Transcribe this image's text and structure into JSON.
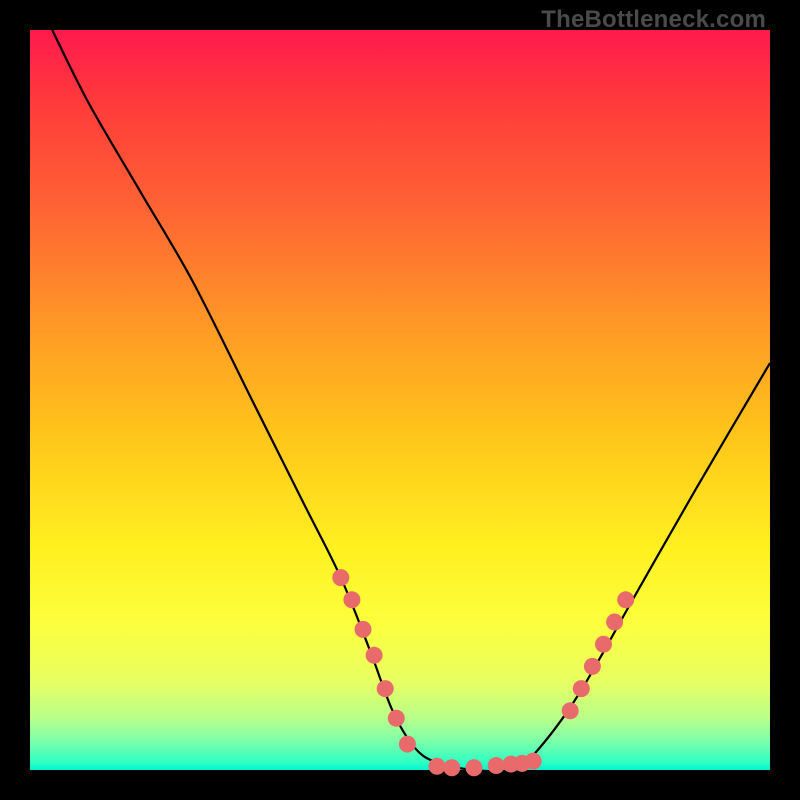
{
  "watermark": "TheBottleneck.com",
  "chart_data": {
    "type": "line",
    "title": "",
    "xlabel": "",
    "ylabel": "",
    "xlim": [
      0,
      100
    ],
    "ylim": [
      0,
      100
    ],
    "series": [
      {
        "name": "curve",
        "x": [
          3,
          8,
          15,
          22,
          30,
          37,
          42,
          46,
          49,
          52,
          55,
          60,
          65,
          68,
          74,
          82,
          90,
          100
        ],
        "values": [
          100,
          90,
          78,
          66,
          50,
          36,
          26,
          16,
          8,
          3,
          1,
          0,
          0,
          2,
          10,
          24,
          38,
          55
        ]
      }
    ],
    "annotations": {
      "dots_left_branch": [
        {
          "x": 42,
          "y": 26
        },
        {
          "x": 43.5,
          "y": 23
        },
        {
          "x": 45,
          "y": 19
        },
        {
          "x": 46.5,
          "y": 15.5
        },
        {
          "x": 48,
          "y": 11
        },
        {
          "x": 49.5,
          "y": 7
        },
        {
          "x": 51,
          "y": 3.5
        }
      ],
      "dots_bottom": [
        {
          "x": 55,
          "y": 0.5
        },
        {
          "x": 57,
          "y": 0.3
        },
        {
          "x": 60,
          "y": 0.3
        },
        {
          "x": 63,
          "y": 0.6
        },
        {
          "x": 65,
          "y": 0.8
        },
        {
          "x": 66.5,
          "y": 0.9
        },
        {
          "x": 68,
          "y": 1.2
        }
      ],
      "dots_right_branch": [
        {
          "x": 73,
          "y": 8
        },
        {
          "x": 74.5,
          "y": 11
        },
        {
          "x": 76,
          "y": 14
        },
        {
          "x": 77.5,
          "y": 17
        },
        {
          "x": 79,
          "y": 20
        },
        {
          "x": 80.5,
          "y": 23
        }
      ]
    }
  }
}
